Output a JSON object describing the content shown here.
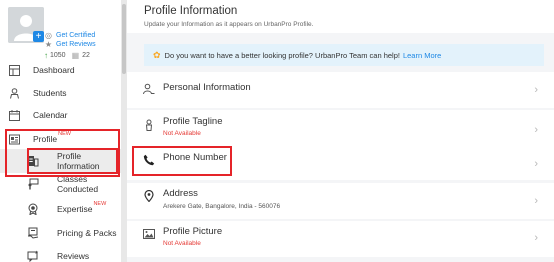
{
  "sidebar": {
    "profile_card": {
      "get_certified": "Get Certified",
      "get_reviews": "Get Reviews",
      "stat_views": "1050",
      "stat_count": "22"
    },
    "nav": [
      {
        "label": "Dashboard",
        "icon": "dashboard-icon"
      },
      {
        "label": "Students",
        "icon": "students-icon"
      },
      {
        "label": "Calendar",
        "icon": "calendar-icon"
      },
      {
        "label": "Profile",
        "icon": "profile-icon",
        "badge": "NEW"
      }
    ],
    "profile_sub": [
      {
        "label": "Profile Information",
        "icon": "profile-info-icon",
        "selected": true
      },
      {
        "label": "Classes Conducted",
        "icon": "classes-icon"
      },
      {
        "label": "Expertise",
        "icon": "expertise-icon",
        "badge": "NEW"
      },
      {
        "label": "Pricing & Packs",
        "icon": "pricing-icon"
      },
      {
        "label": "Reviews",
        "icon": "reviews-icon"
      }
    ]
  },
  "header": {
    "title": "Profile Information",
    "subtitle": "Update your Information as it appears on UrbanPro Profile."
  },
  "banner": {
    "text": "Do you want to have a better looking profile? UrbanPro Team can help!",
    "link": "Learn More"
  },
  "sections": [
    {
      "title": "Personal Information",
      "subtitle": "",
      "icon": "person-icon"
    },
    {
      "title": "Profile Tagline",
      "subtitle": "Not Available",
      "icon": "tagline-icon"
    },
    {
      "title": "Phone Number",
      "subtitle": "",
      "icon": "phone-icon"
    },
    {
      "title": "Address",
      "subtitle": "Arekere Gate, Bangalore, India - 560076",
      "icon": "location-icon"
    },
    {
      "title": "Profile Picture",
      "subtitle": "Not Available",
      "icon": "picture-icon"
    }
  ],
  "colors": {
    "accent": "#1e88e5",
    "highlight": "#e52429",
    "new_badge": "#e53935",
    "banner_bg": "#e3f2fb"
  }
}
